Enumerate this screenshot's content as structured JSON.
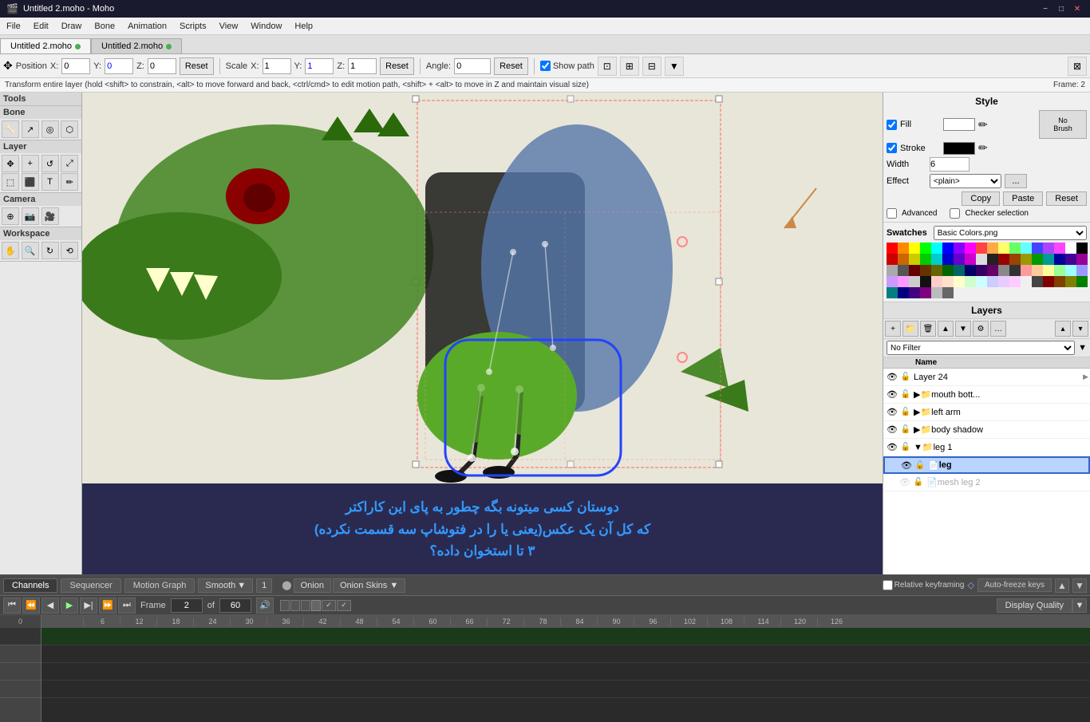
{
  "app": {
    "title": "Untitled 2.moho - Moho",
    "icon": "moho-icon"
  },
  "titlebar": {
    "title": "Untitled 2.moho - Moho",
    "minimize": "−",
    "maximize": "□",
    "close": "✕"
  },
  "menubar": {
    "items": [
      "File",
      "Edit",
      "Draw",
      "Bone",
      "Animation",
      "Scripts",
      "View",
      "Window",
      "Help"
    ]
  },
  "tabs": [
    {
      "label": "Untitled 2.moho",
      "active": true,
      "modified": true
    },
    {
      "label": "Untitled 2.moho",
      "active": false,
      "modified": true
    }
  ],
  "toolbar": {
    "position_label": "Position",
    "x_label": "X:",
    "x_val": "0",
    "y_label": "Y:",
    "y_val": "0",
    "z_label": "Z:",
    "z_val": "0",
    "reset1_label": "Reset",
    "scale_label": "Scale",
    "sx_label": "X:",
    "sx_val": "1",
    "sy_label": "Y:",
    "sy_val": "1",
    "sz_label": "Z:",
    "sz_val": "1",
    "reset2_label": "Reset",
    "angle_label": "Angle:",
    "angle_val": "0",
    "reset3_label": "Reset",
    "show_path": "Show path"
  },
  "statusbar": {
    "hint": "Transform entire layer (hold <shift> to constrain, <alt> to move forward and back, <ctrl/cmd> to edit motion path, <shift> + <alt> to move in Z and maintain visual size)",
    "frame": "Frame: 2"
  },
  "leftpanel": {
    "tools_label": "Tools",
    "bone_label": "Bone",
    "layer_label": "Layer",
    "camera_label": "Camera",
    "workspace_label": "Workspace"
  },
  "canvas": {
    "selection_visible": true,
    "annotation_line1": "دوستان کسی میتونه بگه چطور به پای این کاراکتر",
    "annotation_line2": "که کل آن یک عکس(یعنی یا را در فتوشاپ سه قسمت نکرده)",
    "annotation_line3": "۳ تا استخوان داده؟"
  },
  "style_panel": {
    "title": "Style",
    "fill_label": "Fill",
    "stroke_label": "Stroke",
    "width_label": "Width",
    "width_val": "6",
    "effect_label": "Effect",
    "effect_val": "<plain>",
    "no_brush": "No\nBrush",
    "copy_label": "Copy",
    "paste_label": "Paste",
    "reset_label": "Reset",
    "advanced_label": "Advanced",
    "checker_label": "Checker selection"
  },
  "swatches": {
    "label": "Swatches",
    "preset": "Basic Colors.png",
    "colors": [
      "#ff0000",
      "#ff8800",
      "#ffff00",
      "#00ff00",
      "#00ffff",
      "#0000ff",
      "#8800ff",
      "#ff00ff",
      "#ff4444",
      "#ffaa44",
      "#ffff66",
      "#66ff66",
      "#66ffff",
      "#4444ff",
      "#aa44ff",
      "#ff44ff",
      "#ffffff",
      "#000000",
      "#cc0000",
      "#cc6600",
      "#cccc00",
      "#00cc00",
      "#00cccc",
      "#0000cc",
      "#6600cc",
      "#cc00cc",
      "#dddddd",
      "#222222",
      "#990000",
      "#994400",
      "#999900",
      "#009900",
      "#009999",
      "#000099",
      "#440099",
      "#990099",
      "#aaaaaa",
      "#555555",
      "#660000",
      "#663300",
      "#666600",
      "#006600",
      "#006666",
      "#000066",
      "#330066",
      "#660066",
      "#888888",
      "#333333",
      "#ff9999",
      "#ffcc99",
      "#ffff99",
      "#99ff99",
      "#99ffff",
      "#9999ff",
      "#cc99ff",
      "#ff99ff",
      "#cccccc",
      "#111111",
      "#ffcccc",
      "#ffe0cc",
      "#ffffcc",
      "#ccffcc",
      "#ccffff",
      "#ccccff",
      "#e8ccff",
      "#ffccff",
      "#f0f0f0",
      "#444444",
      "#800000",
      "#804000",
      "#808000",
      "#008000",
      "#008080",
      "#000080",
      "#400080",
      "#800080",
      "#bbbbbb",
      "#666666"
    ]
  },
  "layers": {
    "title": "Layers",
    "filter": "No Filter",
    "headers": [
      "Name"
    ],
    "items": [
      {
        "id": 1,
        "name": "Layer 24",
        "type": "layer",
        "visible": true,
        "locked": false,
        "indent": 0
      },
      {
        "id": 2,
        "name": "mouth bott...",
        "type": "folder",
        "visible": true,
        "locked": false,
        "indent": 0
      },
      {
        "id": 3,
        "name": "left arm",
        "type": "folder",
        "visible": true,
        "locked": false,
        "indent": 0
      },
      {
        "id": 4,
        "name": "body shadow",
        "type": "folder",
        "visible": true,
        "locked": false,
        "indent": 0
      },
      {
        "id": 5,
        "name": "leg 1",
        "type": "folder",
        "visible": true,
        "locked": false,
        "indent": 0,
        "expanded": true
      },
      {
        "id": 6,
        "name": "leg",
        "type": "layer",
        "visible": true,
        "locked": false,
        "indent": 1,
        "selected": true,
        "highlighted": true
      },
      {
        "id": 7,
        "name": "mesh leg 2",
        "type": "layer",
        "visible": false,
        "locked": false,
        "indent": 1
      }
    ]
  },
  "timeline": {
    "channels_tab": "Channels",
    "sequencer_tab": "Sequencer",
    "motion_graph_tab": "Motion Graph",
    "smooth_label": "Smooth",
    "smooth_num": "1",
    "onion_label": "Onion",
    "onion_skins_label": "Onion Skins",
    "relative_keyframe": "Relative keyframing",
    "auto_freeze": "Auto-freeze keys",
    "frame_label": "Frame",
    "frame_val": "2",
    "of_label": "of",
    "total_frames": "60",
    "display_quality": "Display Quality",
    "ticks": [
      "0",
      "6",
      "12",
      "18",
      "24",
      "30",
      "36",
      "42",
      "48",
      "54",
      "60",
      "66",
      "72",
      "78",
      "84",
      "90",
      "96",
      "102",
      "108",
      "114",
      "120",
      "126"
    ]
  },
  "comment": {
    "line1": "دوستان کسی میتونه بگه چطور به پای این کاراکتر",
    "line2": "که کل آن یک عکس(یعنی یا را در فتوشاپ سه قسمت نکرده)",
    "line3": "۳ تا استخوان داده؟"
  }
}
